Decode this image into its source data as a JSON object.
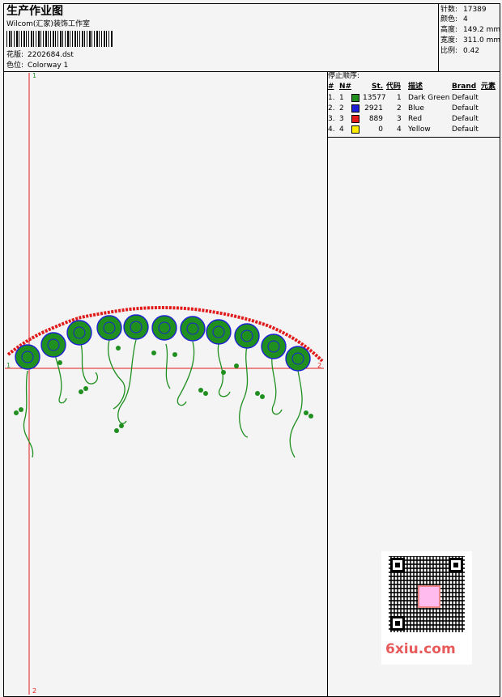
{
  "header": {
    "title": "生产作业图",
    "studio": "Wilcom(汇家)装饰工作室",
    "design_label": "花版:",
    "design_value": "2202684.dst",
    "color_label": "色位:",
    "color_value": "Colorway 1"
  },
  "stats": {
    "stitches_label": "针数:",
    "stitches_value": "17389",
    "colors_label": "颜色:",
    "colors_value": "4",
    "height_label": "高度:",
    "height_value": "149.2 mm",
    "width_label": "宽度:",
    "width_value": "311.0 mm",
    "scale_label": "比例:",
    "scale_value": "0.42"
  },
  "stop_sequence": {
    "title": "停止顺序:",
    "columns": [
      "#",
      "N#",
      "St.",
      "代码",
      "描述",
      "Brand",
      "元素"
    ],
    "rows": [
      {
        "idx": "1.",
        "n": "1",
        "st": "13577",
        "code": "1",
        "desc": "Dark Green",
        "brand": "Default",
        "color": "#1f8f1f"
      },
      {
        "idx": "2.",
        "n": "2",
        "st": "2921",
        "code": "2",
        "desc": "Blue",
        "brand": "Default",
        "color": "#1f1fd6"
      },
      {
        "idx": "3.",
        "n": "3",
        "st": "889",
        "code": "3",
        "desc": "Red",
        "brand": "Default",
        "color": "#e11b1b"
      },
      {
        "idx": "4.",
        "n": "4",
        "st": "0",
        "code": "4",
        "desc": "Yellow",
        "brand": "Default",
        "color": "#ffee00"
      }
    ]
  },
  "markers": {
    "axis_top": "1",
    "axis_bottom": "2",
    "axis_left": "1",
    "axis_right": "2"
  },
  "watermark": {
    "site": "6xiu.com"
  }
}
